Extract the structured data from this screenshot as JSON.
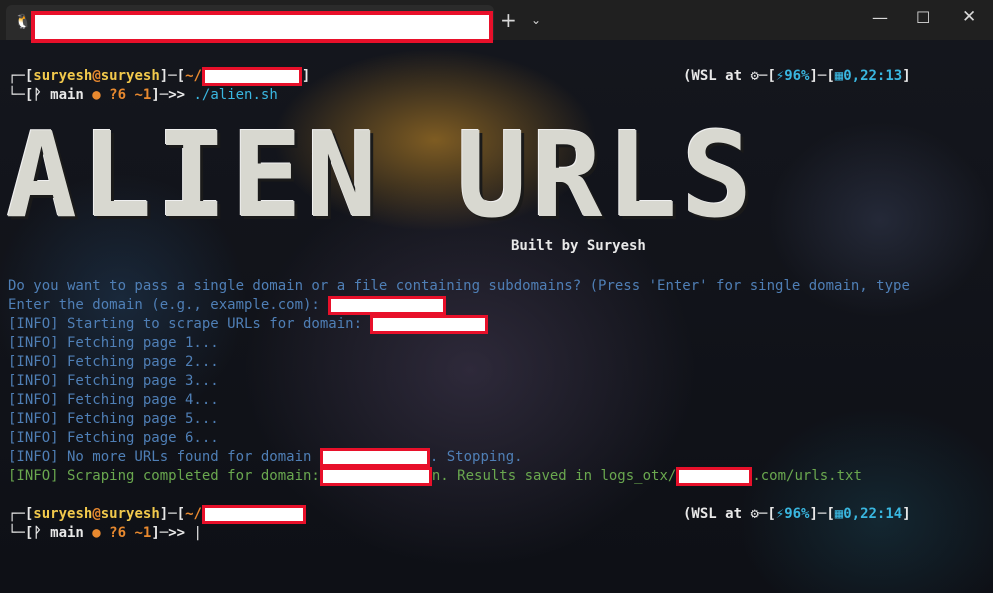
{
  "window": {
    "tab_title": "",
    "plus_icon": "plus-icon",
    "chevron_icon": "chevron-down-icon",
    "minimize_glyph": "—",
    "maximize_glyph": "☐",
    "close_glyph": "✕"
  },
  "prompt1": {
    "user": "suryesh",
    "at": "@",
    "host": "suryesh",
    "dir_prefix": "~/",
    "branch": "main",
    "status_dot": "●",
    "status": "?6 ~1",
    "command": "./alien.sh",
    "wsl_label": "(WSL at",
    "battery": "96%",
    "time": "0,22:13"
  },
  "banner": {
    "logo": "ALIEN URLS",
    "credit": "Built by Suryesh"
  },
  "output": {
    "question": "Do you want to pass a single domain or a file containing subdomains? (Press 'Enter' for single domain, type",
    "enter_domain": "Enter the domain (e.g., example.com): ",
    "starting": "[INFO] Starting to scrape URLs for domain: ",
    "pages": [
      "[INFO] Fetching page 1...",
      "[INFO] Fetching page 2...",
      "[INFO] Fetching page 3...",
      "[INFO] Fetching page 4...",
      "[INFO] Fetching page 5...",
      "[INFO] Fetching page 6..."
    ],
    "no_more_prefix": "[INFO] No more URLs found for domain ",
    "no_more_suffix": ". Stopping.",
    "completed_prefix": "[INFO] Scraping completed for domain:",
    "completed_mid": "n. Results saved in logs_otx/",
    "completed_suffix": ".com/urls.txt"
  },
  "prompt2": {
    "user": "suryesh",
    "at": "@",
    "host": "suryesh",
    "dir_prefix": "~/",
    "branch": "main",
    "status_dot": "●",
    "status": "?6 ~1",
    "wsl_label": "(WSL at",
    "battery": "96%",
    "time": "0,22:14"
  }
}
